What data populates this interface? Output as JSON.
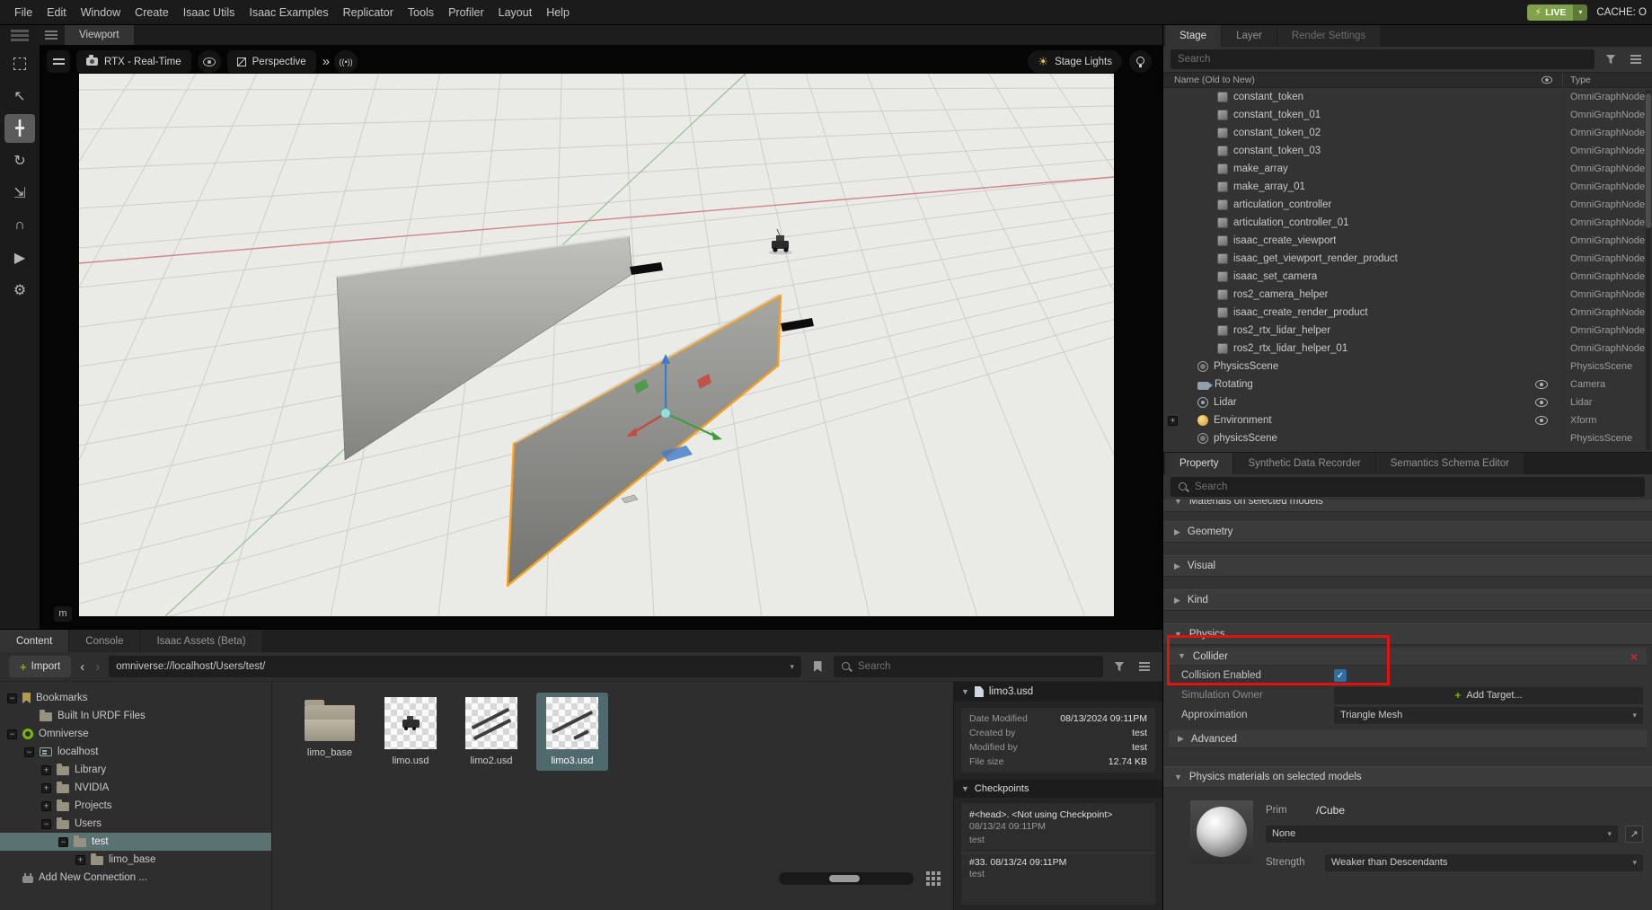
{
  "icons": {
    "close": "×",
    "chevron_down": "▾",
    "chevron_left": "‹",
    "chevron_right": "›",
    "double_chevron": "»",
    "triangle_down": "▼",
    "triangle_right": "▶",
    "sun": "☀",
    "lightning": "⚡",
    "plus": "+",
    "check": "✓",
    "export": "↗",
    "speaker": "((•))"
  },
  "colors": {
    "accent_green": "#76b900",
    "selection_teal": "#5b7272",
    "annotation_red": "#e01212",
    "selected_wall_orange": "#f7a01e"
  },
  "menu": {
    "items": [
      "File",
      "Edit",
      "Window",
      "Create",
      "Isaac Utils",
      "Isaac Examples",
      "Replicator",
      "Tools",
      "Profiler",
      "Layout",
      "Help"
    ],
    "live": "LIVE",
    "cache": "CACHE: O"
  },
  "left_toolbar": {
    "tools": [
      {
        "name": "marquee-select-tool",
        "kind": "dashed"
      },
      {
        "name": "cursor-select-tool",
        "glyph": "↖"
      },
      {
        "name": "move-tool",
        "glyph": "╋",
        "active": true
      },
      {
        "name": "rotate-tool",
        "glyph": "↻"
      },
      {
        "name": "scale-tool",
        "glyph": "⇲"
      },
      {
        "name": "snap-tool",
        "glyph": "∩"
      },
      {
        "name": "play-button",
        "glyph": "▶"
      },
      {
        "name": "physics-tool",
        "glyph": "⚙"
      }
    ]
  },
  "viewport": {
    "tab": "Viewport",
    "renderer": "RTX - Real-Time",
    "camera": "Perspective",
    "lights_button": "Stage Lights",
    "unit": "m"
  },
  "stage": {
    "tabs": [
      "Stage",
      "Layer",
      "Render Settings"
    ],
    "search_placeholder": "Search",
    "name_header": "Name (Old to New)",
    "type_header": "Type",
    "rows": [
      {
        "name": "constant_token",
        "type": "OmniGraphNode",
        "icon": "node",
        "indent": 2
      },
      {
        "name": "constant_token_01",
        "type": "OmniGraphNode",
        "icon": "node",
        "indent": 2
      },
      {
        "name": "constant_token_02",
        "type": "OmniGraphNode",
        "icon": "node",
        "indent": 2
      },
      {
        "name": "constant_token_03",
        "type": "OmniGraphNode",
        "icon": "node",
        "indent": 2
      },
      {
        "name": "make_array",
        "type": "OmniGraphNode",
        "icon": "node",
        "indent": 2
      },
      {
        "name": "make_array_01",
        "type": "OmniGraphNode",
        "icon": "node",
        "indent": 2
      },
      {
        "name": "articulation_controller",
        "type": "OmniGraphNode",
        "icon": "node",
        "indent": 2
      },
      {
        "name": "articulation_controller_01",
        "type": "OmniGraphNode",
        "icon": "node",
        "indent": 2
      },
      {
        "name": "isaac_create_viewport",
        "type": "OmniGraphNode",
        "icon": "node",
        "indent": 2
      },
      {
        "name": "isaac_get_viewport_render_product",
        "type": "OmniGraphNode",
        "icon": "node",
        "indent": 2
      },
      {
        "name": "isaac_set_camera",
        "type": "OmniGraphNode",
        "icon": "node",
        "indent": 2
      },
      {
        "name": "ros2_camera_helper",
        "type": "OmniGraphNode",
        "icon": "node",
        "indent": 2
      },
      {
        "name": "isaac_create_render_product",
        "type": "OmniGraphNode",
        "icon": "node",
        "indent": 2
      },
      {
        "name": "ros2_rtx_lidar_helper",
        "type": "OmniGraphNode",
        "icon": "node",
        "indent": 2
      },
      {
        "name": "ros2_rtx_lidar_helper_01",
        "type": "OmniGraphNode",
        "icon": "node",
        "indent": 2
      },
      {
        "name": "PhysicsScene",
        "type": "PhysicsScene",
        "icon": "physics",
        "indent": 1
      },
      {
        "name": "Rotating",
        "type": "Camera",
        "icon": "camera",
        "indent": 1,
        "eye": true
      },
      {
        "name": "Lidar",
        "type": "Lidar",
        "icon": "lidar",
        "indent": 1,
        "eye": true
      },
      {
        "name": "Environment",
        "type": "Xform",
        "icon": "environment",
        "indent": 1,
        "eye": true,
        "expander": "+"
      },
      {
        "name": "physicsScene",
        "type": "PhysicsScene",
        "icon": "physics",
        "indent": 1
      }
    ]
  },
  "property": {
    "tabs": [
      "Property",
      "Synthetic Data Recorder",
      "Semantics Schema Editor"
    ],
    "search_placeholder": "Search",
    "sections": {
      "materials": "Materials on selected models",
      "geometry": "Geometry",
      "visual": "Visual",
      "kind": "Kind",
      "physics": "Physics"
    },
    "collider": {
      "title": "Collider",
      "collision_label": "Collision Enabled",
      "collision_enabled": true,
      "sim_owner_label": "Simulation Owner",
      "add_target": "Add Target...",
      "approx_label": "Approximation",
      "approx_value": "Triangle Mesh",
      "advanced": "Advanced"
    },
    "materials": {
      "header": "Physics materials on selected models",
      "prim_label": "Prim",
      "prim_value": "/Cube",
      "material_value": "None",
      "strength_label": "Strength",
      "strength_value": "Weaker than Descendants"
    }
  },
  "content": {
    "tabs": [
      "Content",
      "Console",
      "Isaac Assets (Beta)"
    ],
    "import_label": "Import",
    "path": "omniverse://localhost/Users/test/",
    "search_placeholder": "Search",
    "tree": [
      {
        "label": "Bookmarks",
        "icon": "bookmark",
        "indent": 0,
        "expander": "−"
      },
      {
        "label": "Built In URDF Files",
        "icon": "folder",
        "indent": 1
      },
      {
        "label": "Omniverse",
        "icon": "omniverse",
        "indent": 0,
        "expander": "−"
      },
      {
        "label": "localhost",
        "icon": "server",
        "indent": 1,
        "expander": "−"
      },
      {
        "label": "Library",
        "icon": "folder",
        "indent": 2,
        "expander": "+"
      },
      {
        "label": "NVIDIA",
        "icon": "folder",
        "indent": 2,
        "expander": "+"
      },
      {
        "label": "Projects",
        "icon": "folder",
        "indent": 2,
        "expander": "+"
      },
      {
        "label": "Users",
        "icon": "folder",
        "indent": 2,
        "expander": "−"
      },
      {
        "label": "test",
        "icon": "folder",
        "indent": 3,
        "expander": "−",
        "selected": true
      },
      {
        "label": "limo_base",
        "icon": "folder",
        "indent": 4,
        "expander": "+"
      },
      {
        "label": "Add New Connection ...",
        "icon": "plug",
        "indent": 0
      }
    ],
    "files": [
      {
        "label": "limo_base",
        "kind": "folder"
      },
      {
        "label": "limo.usd",
        "kind": "robot"
      },
      {
        "label": "limo2.usd",
        "kind": "rails2"
      },
      {
        "label": "limo3.usd",
        "kind": "rails3",
        "selected": true
      }
    ],
    "details": {
      "title": "limo3.usd",
      "fields": [
        [
          "Date Modified",
          "08/13/2024 09:11PM"
        ],
        [
          "Created by",
          "test"
        ],
        [
          "Modified by",
          "test"
        ],
        [
          "File size",
          "12.74 KB"
        ]
      ],
      "checkpoints_label": "Checkpoints",
      "checkpoints": [
        {
          "title": "#<head>.  <Not using Checkpoint>",
          "time": "08/13/24 09:11PM",
          "author": "test"
        },
        {
          "title": "#33.  08/13/24 09:11PM",
          "author": "test"
        }
      ]
    }
  }
}
